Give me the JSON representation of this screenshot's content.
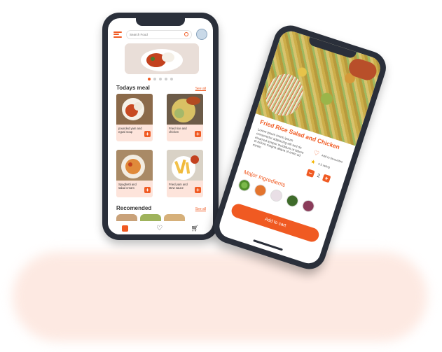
{
  "search": {
    "placeholder": "Search Food"
  },
  "home": {
    "todays_meal": {
      "title": "Todays meal",
      "see_all": "See all"
    },
    "meals": [
      {
        "label": "pounded yam and egusi soup"
      },
      {
        "label": "Fried rice and chicken"
      },
      {
        "label": "Spaghetti and salad cream"
      },
      {
        "label": "Fried yam and stew sauce"
      }
    ],
    "recommended": {
      "title": "Recomended",
      "see_all": "See all"
    }
  },
  "detail": {
    "title": "Fried Rice  Salad and Chicken",
    "description": "Lorem ipsum lorem ipsum consectetur adipiscing elit sed do eiusmod tempor incididunt ut labore et dolore magna aliqua ut enim ad minim",
    "favourite_label": "Add to favourites",
    "rating_label": "4.5 rating",
    "quantity": "2",
    "minus": "−",
    "plus": "+",
    "ingredients_title": "Major Ingredients",
    "cart_label": "Add to cart"
  },
  "icons": {
    "menu": "menu-icon",
    "search": "search-icon",
    "avatar": "avatar",
    "home": "home-icon",
    "heart": "heart-icon",
    "cart": "cart-icon",
    "star": "star-icon"
  },
  "colors": {
    "accent": "#f05a22",
    "card": "#fde4db",
    "frame": "#2a2f3a"
  }
}
